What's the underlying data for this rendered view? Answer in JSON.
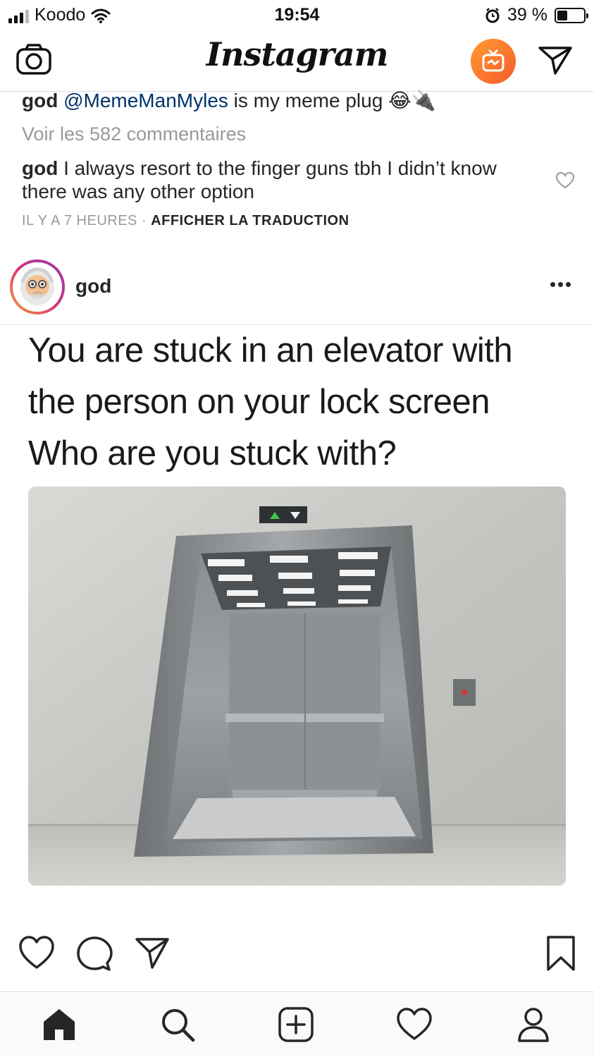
{
  "status_bar": {
    "carrier": "Koodo",
    "time": "19:54",
    "battery_percent": "39 %",
    "battery_level": 0.39
  },
  "nav": {
    "brand": "Instagram",
    "accent_igtv": "#f7742f"
  },
  "comments": [
    {
      "user": "god",
      "mention": "@MemeManMyles",
      "text": " is my meme plug 😂🔌"
    },
    {
      "text": "Voir les 582 commentaires"
    },
    {
      "user": "god",
      "text": " I always resort to the finger guns tbh I didn’t know there was any other option"
    }
  ],
  "comment_meta": {
    "time_ago": "IL Y A 7 HEURES",
    "separator": " · ",
    "translate": "AFFICHER LA TRADUCTION"
  },
  "post": {
    "username": "god",
    "meme_lines": [
      "You are stuck in an elevator with",
      "the person on your lock screen",
      "Who are you stuck with?"
    ]
  },
  "icons": {
    "nav": [
      "camera-icon",
      "igtv-icon",
      "direct-icon"
    ],
    "actions": [
      "heart-icon",
      "comment-icon",
      "share-icon",
      "bookmark-icon"
    ],
    "tabs": [
      "home-icon",
      "search-icon",
      "add-icon",
      "activity-icon",
      "profile-icon"
    ]
  }
}
